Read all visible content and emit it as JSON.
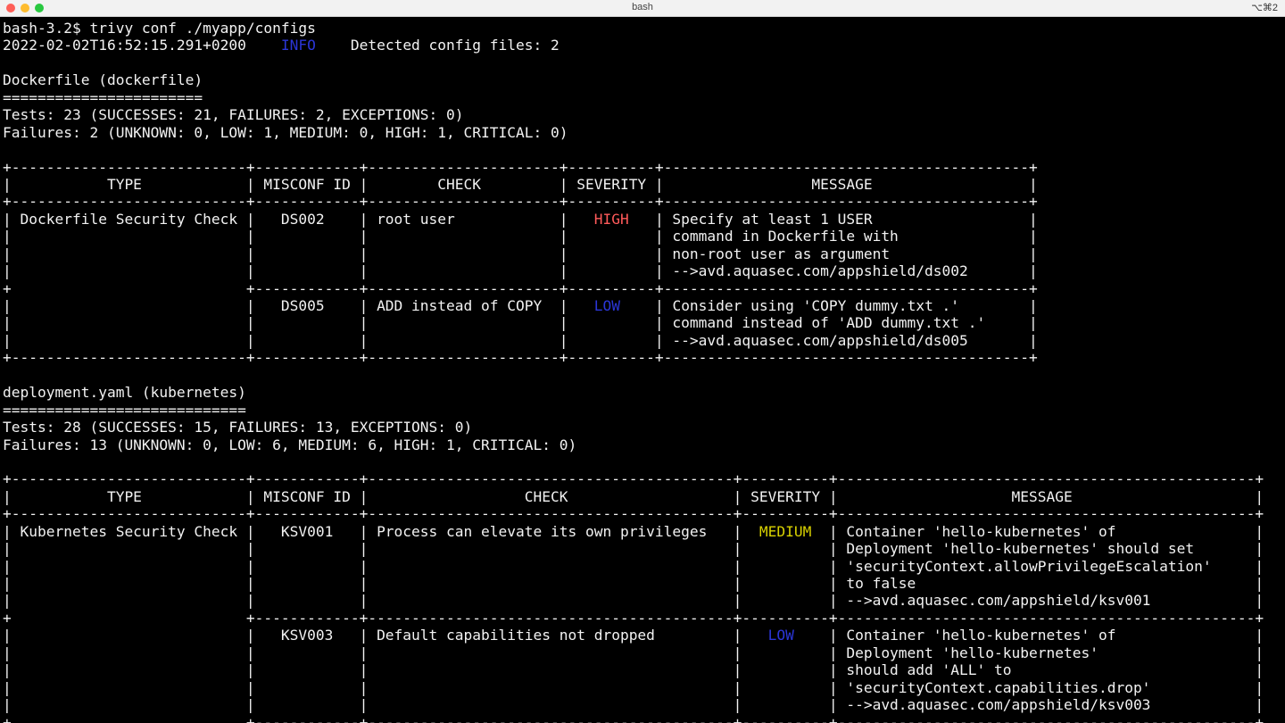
{
  "window": {
    "title": "bash",
    "shortcut": "⌥⌘2"
  },
  "terminal": {
    "lines": [
      [
        {
          "t": "bash-3.2$ trivy conf ./myapp/configs"
        }
      ],
      [
        {
          "t": "2022-02-02T16:52:15.291+0200    "
        },
        {
          "t": "INFO",
          "c": "blue"
        },
        {
          "t": "    Detected config files: 2"
        }
      ],
      [
        {
          "t": ""
        }
      ],
      [
        {
          "t": "Dockerfile (dockerfile)"
        }
      ],
      [
        {
          "t": "======================="
        }
      ],
      [
        {
          "t": "Tests: 23 (SUCCESSES: 21, FAILURES: 2, EXCEPTIONS: 0)"
        }
      ],
      [
        {
          "t": "Failures: 2 (UNKNOWN: 0, LOW: 1, MEDIUM: 0, HIGH: 1, CRITICAL: 0)"
        }
      ],
      [
        {
          "t": ""
        }
      ],
      [
        {
          "t": "+---------------------------+------------+----------------------+----------+------------------------------------------+"
        }
      ],
      [
        {
          "t": "|           TYPE            | MISCONF ID |        CHECK         | SEVERITY |                 MESSAGE                  |"
        }
      ],
      [
        {
          "t": "+---------------------------+------------+----------------------+----------+------------------------------------------+"
        }
      ],
      [
        {
          "t": "| Dockerfile Security Check |   DS002    | root user            |   "
        },
        {
          "t": "HIGH",
          "c": "red"
        },
        {
          "t": "   | Specify at least 1 USER                  |"
        }
      ],
      [
        {
          "t": "|                           |            |                      |          | command in Dockerfile with               |"
        }
      ],
      [
        {
          "t": "|                           |            |                      |          | non-root user as argument                |"
        }
      ],
      [
        {
          "t": "|                           |            |                      |          | -->avd.aquasec.com/appshield/ds002       |"
        }
      ],
      [
        {
          "t": "+                           +------------+----------------------+----------+------------------------------------------+"
        }
      ],
      [
        {
          "t": "|                           |   DS005    | ADD instead of COPY  |   "
        },
        {
          "t": "LOW",
          "c": "blue"
        },
        {
          "t": "    | Consider using 'COPY dummy.txt .'        |"
        }
      ],
      [
        {
          "t": "|                           |            |                      |          | command instead of 'ADD dummy.txt .'     |"
        }
      ],
      [
        {
          "t": "|                           |            |                      |          | -->avd.aquasec.com/appshield/ds005       |"
        }
      ],
      [
        {
          "t": "+---------------------------+------------+----------------------+----------+------------------------------------------+"
        }
      ],
      [
        {
          "t": ""
        }
      ],
      [
        {
          "t": "deployment.yaml (kubernetes)"
        }
      ],
      [
        {
          "t": "============================"
        }
      ],
      [
        {
          "t": "Tests: 28 (SUCCESSES: 15, FAILURES: 13, EXCEPTIONS: 0)"
        }
      ],
      [
        {
          "t": "Failures: 13 (UNKNOWN: 0, LOW: 6, MEDIUM: 6, HIGH: 1, CRITICAL: 0)"
        }
      ],
      [
        {
          "t": ""
        }
      ],
      [
        {
          "t": "+---------------------------+------------+------------------------------------------+----------+------------------------------------------------+"
        }
      ],
      [
        {
          "t": "|           TYPE            | MISCONF ID |                  CHECK                   | SEVERITY |                    MESSAGE                     |"
        }
      ],
      [
        {
          "t": "+---------------------------+------------+------------------------------------------+----------+------------------------------------------------+"
        }
      ],
      [
        {
          "t": "| Kubernetes Security Check |   KSV001   | Process can elevate its own privileges   |  "
        },
        {
          "t": "MEDIUM",
          "c": "yellow"
        },
        {
          "t": "  | Container 'hello-kubernetes' of                |"
        }
      ],
      [
        {
          "t": "|                           |            |                                          |          | Deployment 'hello-kubernetes' should set       |"
        }
      ],
      [
        {
          "t": "|                           |            |                                          |          | 'securityContext.allowPrivilegeEscalation'     |"
        }
      ],
      [
        {
          "t": "|                           |            |                                          |          | to false                                       |"
        }
      ],
      [
        {
          "t": "|                           |            |                                          |          | -->avd.aquasec.com/appshield/ksv001            |"
        }
      ],
      [
        {
          "t": "+                           +------------+------------------------------------------+----------+------------------------------------------------+"
        }
      ],
      [
        {
          "t": "|                           |   KSV003   | Default capabilities not dropped         |   "
        },
        {
          "t": "LOW",
          "c": "blue"
        },
        {
          "t": "    | Container 'hello-kubernetes' of                |"
        }
      ],
      [
        {
          "t": "|                           |            |                                          |          | Deployment 'hello-kubernetes'                  |"
        }
      ],
      [
        {
          "t": "|                           |            |                                          |          | should add 'ALL' to                            |"
        }
      ],
      [
        {
          "t": "|                           |            |                                          |          | 'securityContext.capabilities.drop'            |"
        }
      ],
      [
        {
          "t": "|                           |            |                                          |          | -->avd.aquasec.com/appshield/ksv003            |"
        }
      ],
      [
        {
          "t": "+                           +------------+------------------------------------------+----------+------------------------------------------------+"
        }
      ]
    ]
  }
}
